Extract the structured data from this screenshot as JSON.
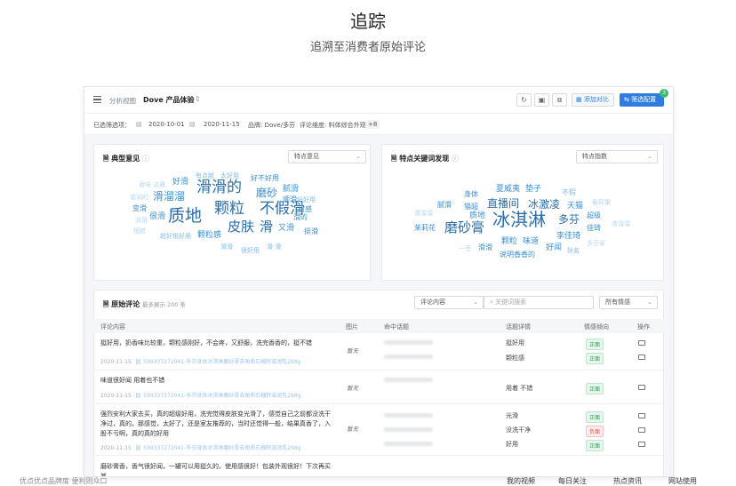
{
  "hero": {
    "title": "追踪",
    "subtitle": "追溯至消费者原始评论"
  },
  "topbar": {
    "crumb": "分析视图",
    "product": "Dove 产品体验",
    "compare": "添加对比",
    "filter": "筛选配置",
    "badge": "3"
  },
  "filters": {
    "label": "已选筛选项：",
    "date_from": "2020-10-01",
    "date_to": "2020-11-15",
    "brand": "品牌: Dove/多芬",
    "dimension": "评论维度: 料体综合外观",
    "more": "+8"
  },
  "typical": {
    "title": "典型意见",
    "select": "特点意见",
    "words": [
      "滑滑的",
      "颗粒",
      "不假滑",
      "质地",
      "皮肤",
      "滑",
      "磨砂",
      "滑溜溜",
      "很滑",
      "颗粒感",
      "又滑",
      "超好用好用",
      "好滑",
      "好不好用",
      "腻滑",
      "顺滑",
      "质感",
      "滑的",
      "好好用",
      "挺滑",
      "变滑",
      "有点腻",
      "太好用",
      "香味 淡雅",
      "滋润的",
      "润滑",
      "细腻",
      "滑滑",
      "很好用",
      "滑 滑",
      "搓起来"
    ]
  },
  "keywords": {
    "title": "特点关键词发现",
    "select": "特点指数",
    "words": [
      "冰淇淋",
      "磨砂膏",
      "直播间",
      "冰激凌",
      "多芬",
      "质地",
      "颗粒",
      "味道",
      "李佳琦",
      "好闻",
      "说明香香的",
      "夏威夷",
      "垫子",
      "不假",
      "身体",
      "腻滑",
      "猫超",
      "天猫",
      "超级",
      "佳琦",
      "奢异果",
      "滑溜溜",
      "茉莉花",
      "一豆",
      "滑滑",
      "狄名",
      "多芬家",
      "浓溜溜",
      "颗粒感"
    ]
  },
  "reviews": {
    "title": "原始评论",
    "note": "最多展示 200 条",
    "search_select": "评论内容",
    "search_placeholder": "关键词搜索",
    "sentiment_select": "所有情感",
    "headers": [
      "评论内容",
      "图片",
      "命中话题",
      "话题详情",
      "情感倾向",
      "操作"
    ],
    "rows": [
      {
        "text": "挺好用，奶香味比较重，颗粒感刚好，不会疼，又舒服，洗完香香的，挺不错",
        "date": "2020-11-15",
        "id": "599337272041-多芬身体冰淇淋磨砂膏去角质石榴籽滋润乳298g",
        "img": "暂无",
        "details": [
          "挺好用",
          "颗粒感"
        ],
        "tags": [
          "正面",
          "正面"
        ]
      },
      {
        "text": "味道很好闻 用着也不错",
        "date": "2020-11-15",
        "id": "599337272041-多芬身体冰淇淋磨砂膏去角质石榴籽滋润乳298g",
        "img": "暂无",
        "details": [
          "用着 不错"
        ],
        "tags": [
          "正面"
        ]
      },
      {
        "text": "强烈安利大家去买，真的超级好用，洗完觉得皮肤变光滑了，感觉自己之前都没洗干净过，真的。那感觉，太好了，还是室友推荐的，当时还觉得一般，结果真香了，入股不亏啊，真的真的好用",
        "date": "2020-11-15",
        "id": "599337272041-多芬身体冰淇淋磨砂膏去角质石榴籽滋润乳298g",
        "img": "暂无",
        "details": [
          "光滑",
          "没洗干净",
          "好用"
        ],
        "tags": [
          "正面",
          "负面",
          "正面"
        ]
      },
      {
        "text": "磨砂膏香，香气很好闻，一罐可以用挺久的。使用感很好！包装外观很好！下次再买其",
        "date": "",
        "id": "",
        "img": "",
        "details": [],
        "tags": []
      }
    ]
  },
  "bottom": [
    "优点优点品牌度 便利则众口",
    "我的视频",
    "每日关注",
    "热点资讯",
    "网站使用"
  ]
}
